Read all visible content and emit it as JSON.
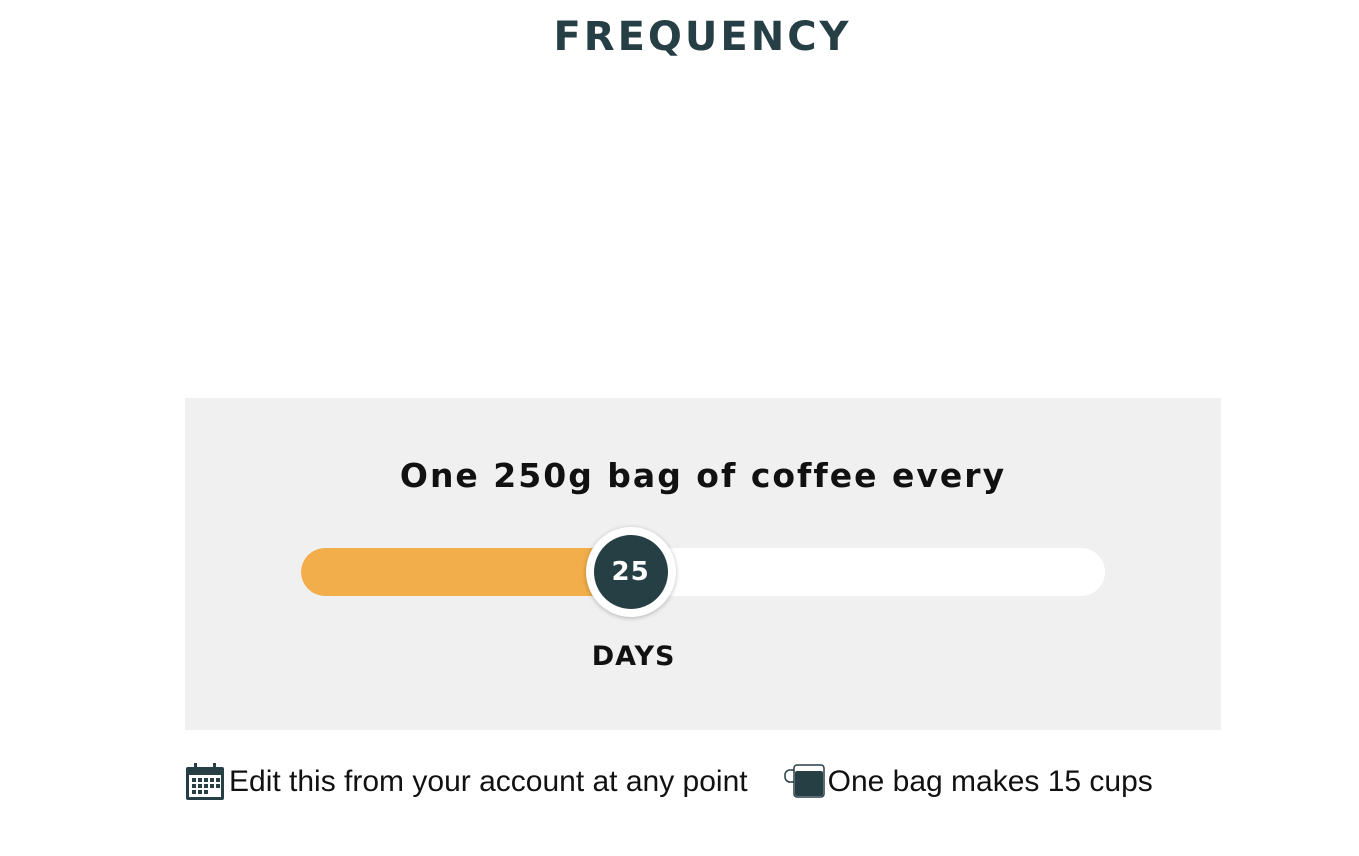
{
  "section": {
    "title": "FREQUENCY"
  },
  "frequency_panel": {
    "heading": "One 250g bag of coffee every",
    "slider": {
      "value": "25",
      "unit": "DAYS",
      "fill_fraction": 0.41
    }
  },
  "info": {
    "edit_text": "Edit this from your account at any point",
    "edit_icon": "calendar-icon",
    "cups_text": "One bag makes 15 cups",
    "cups_icon": "cup-icon"
  },
  "colors": {
    "title": "#263f45",
    "track_fill": "#f2ae4a",
    "thumb": "#263f45",
    "panel_bg": "#f0f0f0"
  }
}
